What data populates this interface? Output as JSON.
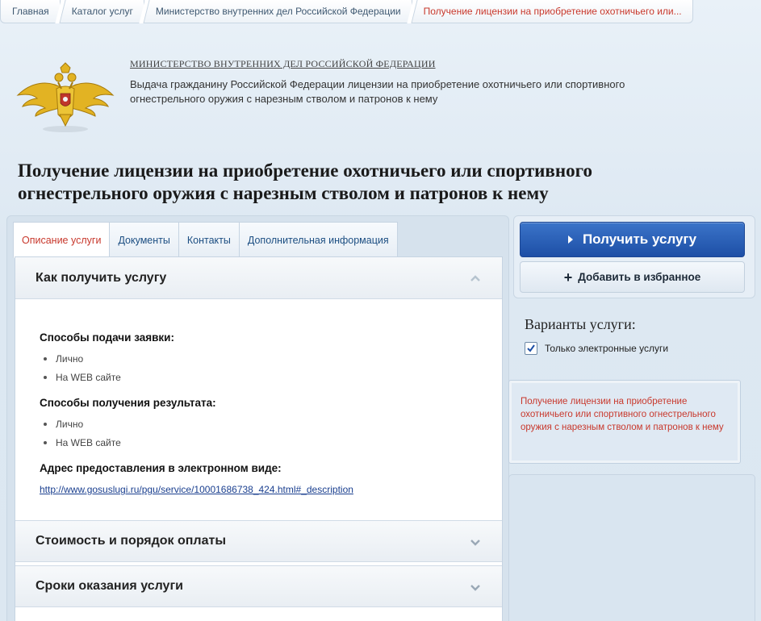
{
  "breadcrumb": [
    {
      "label": "Главная"
    },
    {
      "label": "Каталог услуг"
    },
    {
      "label": "Министерство внутренних дел Российской Федерации"
    },
    {
      "label": "Получение лицензии на приобретение охотничьего или..."
    }
  ],
  "ministry": {
    "name": "МИНИСТЕРСТВО ВНУТРЕННИХ ДЕЛ РОССИЙСКОЙ ФЕДЕРАЦИИ",
    "description": "Выдача гражданину Российской Федерации лицензии на приобретение охотничьего или спортивного огнестрельного оружия с нарезным стволом и патронов к нему",
    "emblem_icon": "double-headed-eagle-emblem"
  },
  "page": {
    "title": "Получение лицензии на приобретение охотничьего или спортивного огнестрельного оружия с нарезным стволом и патронов к нему"
  },
  "tabs": [
    {
      "label": "Описание услуги",
      "active": true
    },
    {
      "label": "Документы",
      "active": false
    },
    {
      "label": "Контакты",
      "active": false
    },
    {
      "label": "Дополнительная информация",
      "active": false
    }
  ],
  "accordion": {
    "how_to": {
      "title": "Как получить услугу",
      "expanded": true,
      "submit_heading": "Способы подачи заявки:",
      "submit_methods": [
        "Лично",
        "На WEB сайте"
      ],
      "result_heading": "Способы получения результата:",
      "result_methods": [
        "Лично",
        "На WEB сайте"
      ],
      "address_heading": "Адрес предоставления в электронном виде:",
      "address_link": "http://www.gosuslugi.ru/pgu/service/10001686738_424.html#_description"
    },
    "cost": {
      "title": "Стоимость и порядок оплаты",
      "expanded": false
    },
    "terms": {
      "title": "Сроки оказания услуги",
      "expanded": false
    }
  },
  "actions": {
    "get_service": "Получить услугу",
    "add_favorite": "Добавить в избранное"
  },
  "variants": {
    "title": "Варианты услуги:",
    "only_electronic_label": "Только электронные услуги",
    "only_electronic_checked": true,
    "selected_variant": "Получение лицензии на приобретение охотничьего или спортивного огнестрельного оружия с нарезным стволом и патронов к нему"
  },
  "colors": {
    "accent_red": "#c8382c",
    "primary_blue": "#1d4fa6",
    "link_blue": "#1a3f8f"
  }
}
